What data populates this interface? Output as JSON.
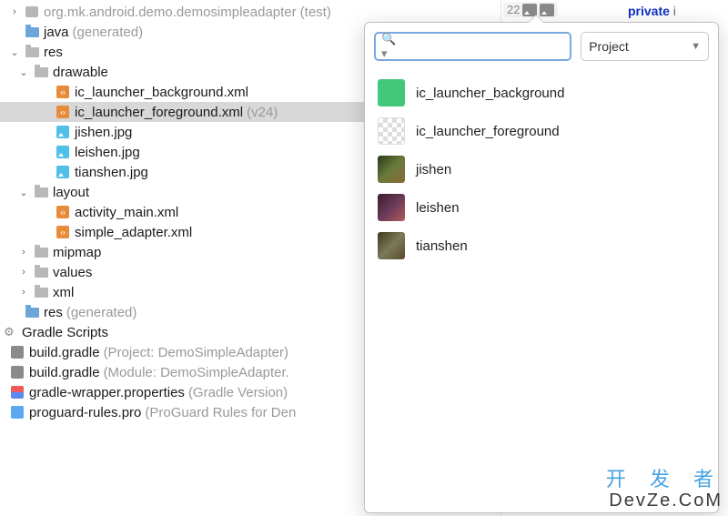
{
  "tree": {
    "r0_label": "org.mk.android.demo.demosimpleadapter",
    "r0_suffix": "(test)",
    "r1_label": "java",
    "r1_suffix": "(generated)",
    "r2_label": "res",
    "r3_label": "drawable",
    "r4_label": "ic_launcher_background.xml",
    "r5_label": "ic_launcher_foreground.xml",
    "r5_suffix": "(v24)",
    "r6_label": "jishen.jpg",
    "r7_label": "leishen.jpg",
    "r8_label": "tianshen.jpg",
    "r9_label": "layout",
    "r10_label": "activity_main.xml",
    "r11_label": "simple_adapter.xml",
    "r12_label": "mipmap",
    "r13_label": "values",
    "r14_label": "xml",
    "r15_label": "res",
    "r15_suffix": "(generated)",
    "r16_label": "Gradle Scripts",
    "r17_label": "build.gradle",
    "r17_suffix": "(Project: DemoSimpleAdapter)",
    "r18_label": "build.gradle",
    "r18_suffix": "(Module: DemoSimpleAdapter.",
    "r19_label": "gradle-wrapper.properties",
    "r19_suffix": "(Gradle Version)",
    "r20_label": "proguard-rules.pro",
    "r20_suffix": "(ProGuard Rules for Den"
  },
  "gutter": {
    "number": "22"
  },
  "code": {
    "line1_kw": "private",
    "line1_rest": " i"
  },
  "popup": {
    "scope": "Project",
    "results": {
      "r0": "ic_launcher_background",
      "r1": "ic_launcher_foreground",
      "r2": "jishen",
      "r3": "leishen",
      "r4": "tianshen"
    }
  },
  "watermark": {
    "line1": "开 发 者",
    "line2": "DevZe.CoM"
  }
}
